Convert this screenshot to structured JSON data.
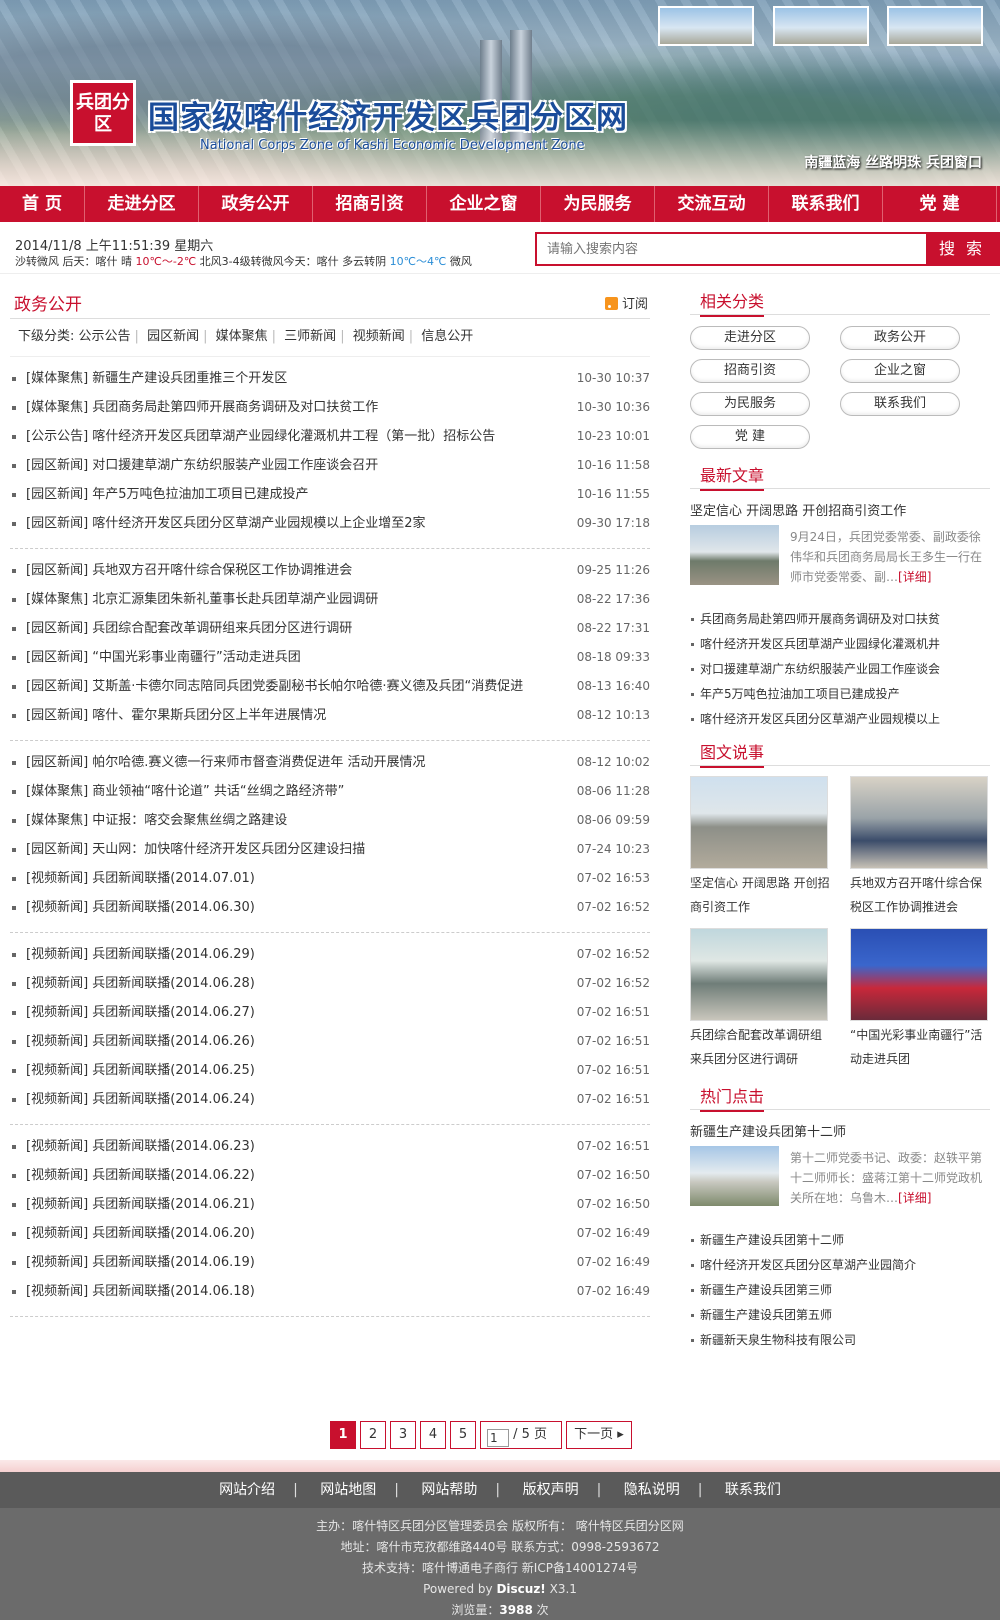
{
  "header": {
    "seal_text": "兵团分区",
    "title": "国家级喀什经济开发区兵团分区网",
    "subtitle": "National Corps Zone of Kashi Economic Development Zone",
    "slogan": "南疆蓝海  丝路明珠  兵团窗口"
  },
  "nav": [
    "首 页",
    "走进分区",
    "政务公开",
    "招商引资",
    "企业之窗",
    "为民服务",
    "交流互动",
    "联系我们",
    "党 建"
  ],
  "infobar": {
    "datetime": "2014/11/8 上午11:51:39 星期六",
    "weather_pre": "沙转微风  后天：喀什  晴 ",
    "weather_t1": "10℃～-2℃",
    "weather_mid": " 北风3-4级转微风今天：喀什  多云转阴 ",
    "weather_t2": "10℃～4℃",
    "weather_post": " 微风"
  },
  "search": {
    "placeholder": "请输入搜索内容",
    "button": "搜 索"
  },
  "main": {
    "title": "政务公开",
    "rss": "订阅",
    "subcat_label": "下级分类:",
    "subcats": [
      "公示公告",
      "园区新闻",
      "媒体聚焦",
      "三师新闻",
      "视频新闻",
      "信息公开"
    ],
    "groups": [
      [
        {
          "text": "[媒体聚焦] 新疆生产建设兵团重推三个开发区",
          "date": "10-30 10:37"
        },
        {
          "text": "[媒体聚焦] 兵团商务局赴第四师开展商务调研及对口扶贫工作",
          "date": "10-30 10:36"
        },
        {
          "text": "[公示公告] 喀什经济开发区兵团草湖产业园绿化灌溉机井工程（第一批）招标公告",
          "date": "10-23 10:01"
        },
        {
          "text": "[园区新闻] 对口援建草湖广东纺织服装产业园工作座谈会召开",
          "date": "10-16 11:58"
        },
        {
          "text": "[园区新闻] 年产5万吨色拉油加工项目已建成投产",
          "date": "10-16 11:55"
        },
        {
          "text": "[园区新闻] 喀什经济开发区兵团分区草湖产业园规模以上企业增至2家",
          "date": "09-30 17:18"
        }
      ],
      [
        {
          "text": "[园区新闻] 兵地双方召开喀什综合保税区工作协调推进会",
          "date": "09-25 11:26"
        },
        {
          "text": "[媒体聚焦] 北京汇源集团朱新礼董事长赴兵团草湖产业园调研",
          "date": "08-22 17:36"
        },
        {
          "text": "[园区新闻] 兵团综合配套改革调研组来兵团分区进行调研",
          "date": "08-22 17:31"
        },
        {
          "text": "[园区新闻] “中国光彩事业南疆行”活动走进兵团",
          "date": "08-18 09:33"
        },
        {
          "text": "[园区新闻] 艾斯盖·卡德尔同志陪同兵团党委副秘书长帕尔哈德·赛义德及兵团“消费促进",
          "date": "08-13 16:40"
        },
        {
          "text": "[园区新闻] 喀什、霍尔果斯兵团分区上半年进展情况",
          "date": "08-12 10:13"
        }
      ],
      [
        {
          "text": "[园区新闻] 帕尔哈德.赛义德一行来师市督查消费促进年 活动开展情况",
          "date": "08-12 10:02"
        },
        {
          "text": "[媒体聚焦] 商业领袖“喀什论道” 共话“丝绸之路经济带”",
          "date": "08-06 11:28"
        },
        {
          "text": "[媒体聚焦] 中证报：喀交会聚焦丝绸之路建设",
          "date": "08-06 09:59"
        },
        {
          "text": "[园区新闻] 天山网：加快喀什经济开发区兵团分区建设扫描",
          "date": "07-24 10:23"
        },
        {
          "text": "[视频新闻] 兵团新闻联播(2014.07.01)",
          "date": "07-02 16:53"
        },
        {
          "text": "[视频新闻] 兵团新闻联播(2014.06.30)",
          "date": "07-02 16:52"
        }
      ],
      [
        {
          "text": "[视频新闻] 兵团新闻联播(2014.06.29)",
          "date": "07-02 16:52"
        },
        {
          "text": "[视频新闻] 兵团新闻联播(2014.06.28)",
          "date": "07-02 16:52"
        },
        {
          "text": "[视频新闻] 兵团新闻联播(2014.06.27)",
          "date": "07-02 16:51"
        },
        {
          "text": "[视频新闻] 兵团新闻联播(2014.06.26)",
          "date": "07-02 16:51"
        },
        {
          "text": "[视频新闻] 兵团新闻联播(2014.06.25)",
          "date": "07-02 16:51"
        },
        {
          "text": "[视频新闻] 兵团新闻联播(2014.06.24)",
          "date": "07-02 16:51"
        }
      ],
      [
        {
          "text": "[视频新闻] 兵团新闻联播(2014.06.23)",
          "date": "07-02 16:51"
        },
        {
          "text": "[视频新闻] 兵团新闻联播(2014.06.22)",
          "date": "07-02 16:50"
        },
        {
          "text": "[视频新闻] 兵团新闻联播(2014.06.21)",
          "date": "07-02 16:50"
        },
        {
          "text": "[视频新闻] 兵团新闻联播(2014.06.20)",
          "date": "07-02 16:49"
        },
        {
          "text": "[视频新闻] 兵团新闻联播(2014.06.19)",
          "date": "07-02 16:49"
        },
        {
          "text": "[视频新闻] 兵团新闻联播(2014.06.18)",
          "date": "07-02 16:49"
        }
      ]
    ]
  },
  "pager": {
    "pages": [
      "1",
      "2",
      "3",
      "4",
      "5"
    ],
    "current": "1",
    "input_value": "1",
    "total": " / 5 页",
    "next": "下一页 ▸"
  },
  "side": {
    "related_title": "相关分类",
    "categories": [
      "走进分区",
      "政务公开",
      "招商引资",
      "企业之窗",
      "为民服务",
      "联系我们",
      "党 建"
    ],
    "latest_title": "最新文章",
    "latest_lead": "坚定信心 开阔思路 开创招商引资工作",
    "latest_summary": "9月24日，兵团党委常委、副政委徐伟华和兵团商务局局长王多生一行在师市党委常委、副…",
    "detail": "[详细]",
    "latest_list": [
      "兵团商务局赴第四师开展商务调研及对口扶贫",
      "喀什经济开发区兵团草湖产业园绿化灌溉机井",
      "对口援建草湖广东纺织服装产业园工作座谈会",
      "年产5万吨色拉油加工项目已建成投产",
      "喀什经济开发区兵团分区草湖产业园规模以上"
    ],
    "gallery_title": "图文说事",
    "gallery": [
      "坚定信心 开阔思路 开创招商引资工作",
      "兵地双方召开喀什综合保税区工作协调推进会",
      "兵团综合配套改革调研组来兵团分区进行调研",
      "“中国光彩事业南疆行”活动走进兵团"
    ],
    "hot_title": "热门点击",
    "hot_lead": "新疆生产建设兵团第十二师",
    "hot_summary": "第十二师党委书记、政委：赵轶平第十二师师长：盛蒋江第十二师党政机关所在地：乌鲁木…",
    "hot_list": [
      "新疆生产建设兵团第十二师",
      "喀什经济开发区兵团分区草湖产业园简介",
      "新疆生产建设兵团第三师",
      "新疆生产建设兵团第五师",
      "新疆新天泉生物科技有限公司"
    ]
  },
  "footer": {
    "links": [
      "网站介绍",
      "网站地图",
      "网站帮助",
      "版权声明",
      "隐私说明",
      "联系我们"
    ],
    "line1": "主办：喀什特区兵团分区管理委员会  版权所有：  喀什特区兵团分区网",
    "line2": "地址：喀什市克孜都维路440号  联系方式：0998-2593672",
    "line3": "技术支持：喀什博通电子商行 新ICP备14001274号",
    "powered_pre": "Powered by ",
    "powered_brand": "Discuz!",
    "powered_ver": " X3.1",
    "views_label": "浏览量：",
    "views": "3988",
    "views_unit": " 次"
  },
  "colors": {
    "brand_red": "#c8102e",
    "footer_gray": "#6b6b6b"
  }
}
